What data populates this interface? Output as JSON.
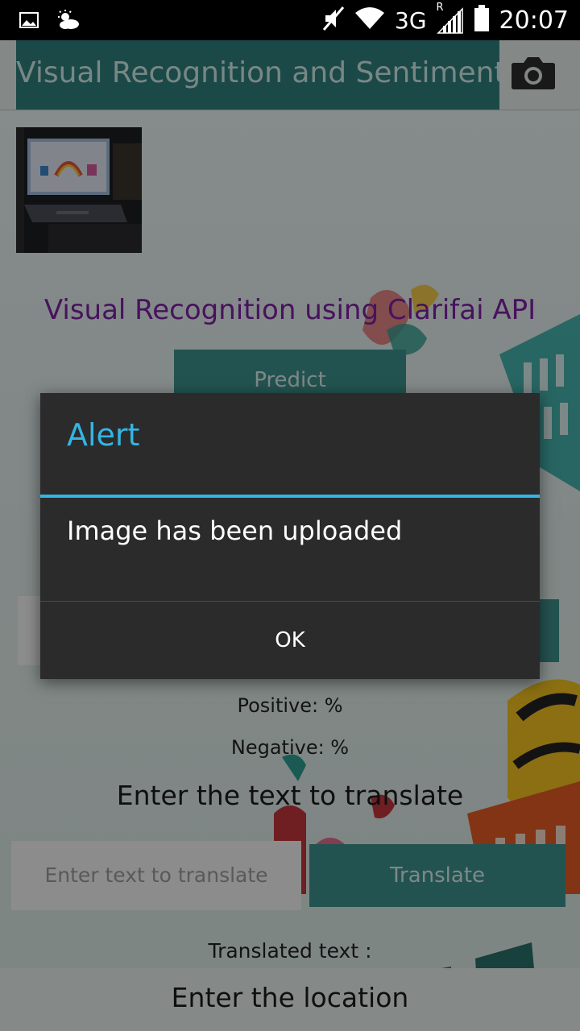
{
  "status_bar": {
    "network": "3G",
    "roaming": "R",
    "time": "20:07",
    "icons": [
      "gallery-icon",
      "weather-icon",
      "mute-icon",
      "wifi-icon",
      "signal-icon",
      "battery-icon"
    ]
  },
  "app_bar": {
    "title": "Visual Recognition and Sentimenta",
    "camera_icon": "camera-icon"
  },
  "main": {
    "visual_heading": "Visual Recognition using Clarifai API",
    "predict_label": "Predict",
    "positive_text": "Positive: %",
    "negative_text": "Negative: %",
    "translate_heading": "Enter the text to translate",
    "translate_placeholder": "Enter text to translate",
    "translate_button": "Translate",
    "translated_label": "Translated text :",
    "location_heading": "Enter the location"
  },
  "dialog": {
    "title": "Alert",
    "message": "Image has been uploaded",
    "ok_label": "OK"
  },
  "colors": {
    "accent_blue": "#33b5e5",
    "teal": "#3d8f8a",
    "purple": "#7b1fa2",
    "dialog_bg": "#2b2b2b"
  }
}
